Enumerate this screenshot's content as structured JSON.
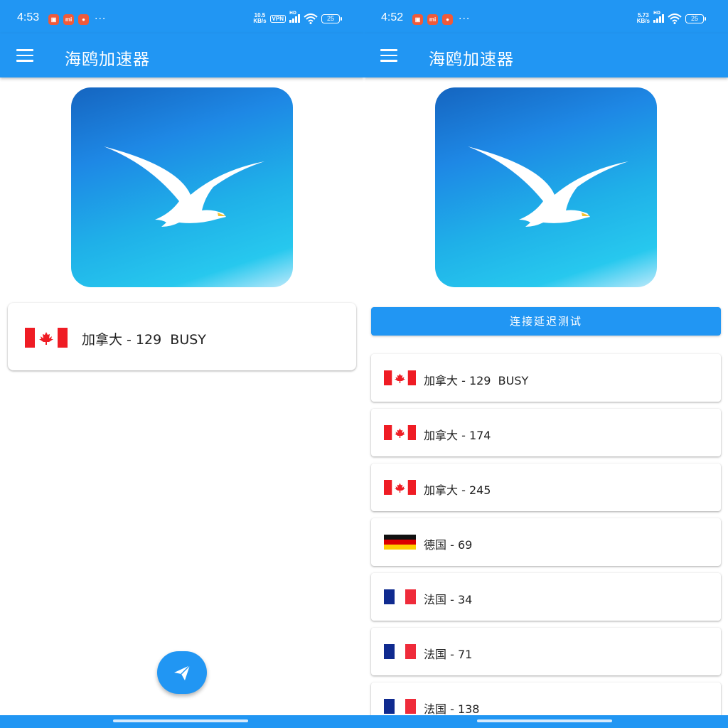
{
  "colors": {
    "primary": "#2196f3",
    "canada_red": "#ef1c24",
    "france_blue": "#0f2a8f",
    "france_red": "#ef2b3a"
  },
  "left": {
    "status": {
      "time": "4:53",
      "speed_value": "10.5",
      "speed_unit": "KB/s",
      "vpn": "VPN",
      "hd": "HD",
      "battery": "25",
      "more": "···",
      "notif_icons": [
        "shopping-bag-icon",
        "mi-icon",
        "app-icon"
      ]
    },
    "appbar": {
      "title": "海鸥加速器"
    },
    "selected_server": {
      "flag": "canada-flag-icon",
      "label": "加拿大 - 129  BUSY"
    },
    "fab": {
      "icon": "send-icon"
    }
  },
  "right": {
    "status": {
      "time": "4:52",
      "speed_value": "5.73",
      "speed_unit": "KB/s",
      "hd": "HD",
      "battery": "25",
      "more": "···",
      "notif_icons": [
        "shopping-bag-icon",
        "mi-icon",
        "app-icon"
      ]
    },
    "appbar": {
      "title": "海鸥加速器"
    },
    "test_button": "连接延迟测试",
    "servers": [
      {
        "flag": "canada",
        "label": "加拿大 - 129  BUSY"
      },
      {
        "flag": "canada",
        "label": "加拿大 - 174"
      },
      {
        "flag": "canada",
        "label": "加拿大 - 245"
      },
      {
        "flag": "germany",
        "label": "德国 - 69"
      },
      {
        "flag": "france",
        "label": "法国 - 34"
      },
      {
        "flag": "france",
        "label": "法国 - 71"
      },
      {
        "flag": "france",
        "label": "法国 - 138"
      }
    ]
  }
}
